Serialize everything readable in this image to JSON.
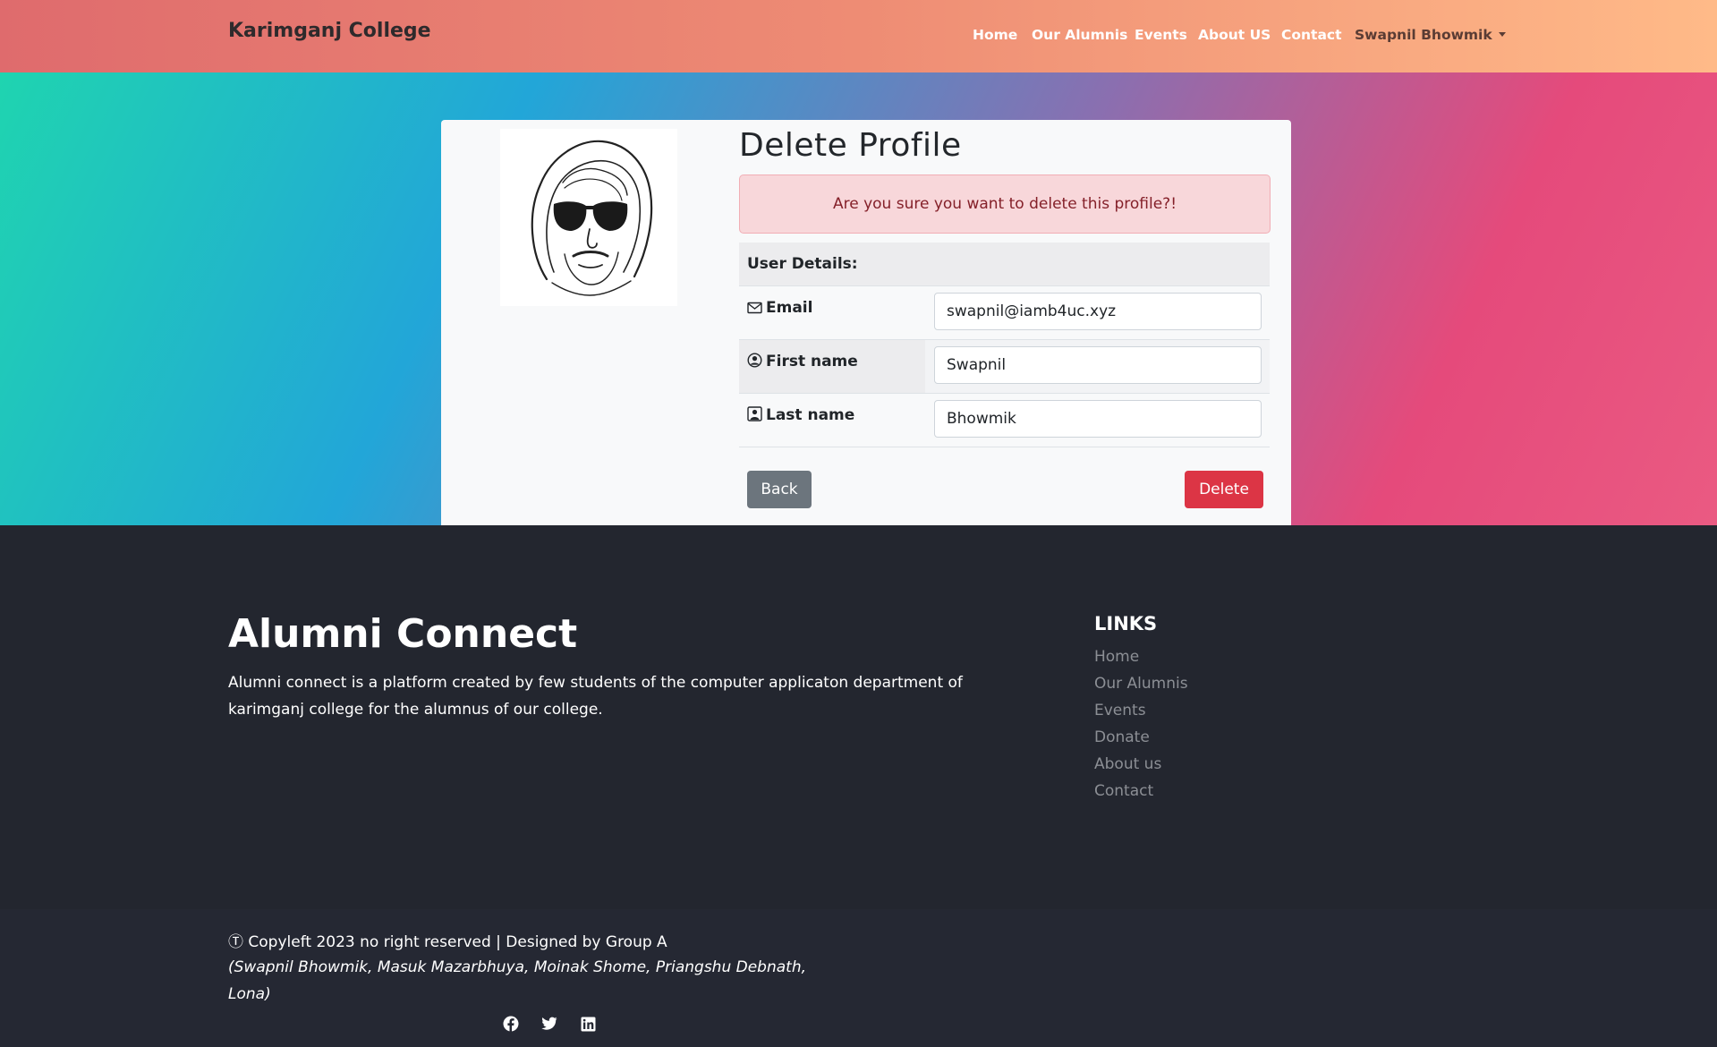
{
  "navbar": {
    "brand": "Karimganj College",
    "links": [
      "Home",
      "Our Alumnis",
      "Events",
      "About US",
      "Contact"
    ],
    "user": "Swapnil Bhowmik"
  },
  "profile": {
    "title": "Delete Profile",
    "alert": "Are you sure you want to delete this profile?!",
    "details_header": "User Details:",
    "fields": [
      {
        "icon": "envelope-icon",
        "label": "Email",
        "value": "swapnil@iamb4uc.xyz"
      },
      {
        "icon": "person-circle-icon",
        "label": "First name",
        "value": "Swapnil"
      },
      {
        "icon": "person-square-icon",
        "label": "Last name",
        "value": "Bhowmik"
      }
    ],
    "back_label": "Back",
    "delete_label": "Delete"
  },
  "footer": {
    "title": "Alumni Connect",
    "description": "Alumni connect is a platform created by few students of the computer applicaton department of karimganj college for the alumnus of our college.",
    "links_title": "LINKS",
    "links": [
      "Home",
      "Our Alumnis",
      "Events",
      "Donate",
      "About us",
      "Contact"
    ],
    "copyright": "Copyleft 2023 no right reserved | Designed by Group A",
    "authors": "(Swapnil Bhowmik, Masuk Mazarbhuya, Moinak Shome, Priangshu Debnath, Lona)",
    "social": [
      "facebook-icon",
      "twitter-icon",
      "linkedin-icon"
    ]
  },
  "colors": {
    "alert_bg": "#f8d7da",
    "alert_text": "#842029",
    "danger": "#dc3545",
    "secondary": "#6c757d",
    "footer_bg": "#23262f"
  }
}
